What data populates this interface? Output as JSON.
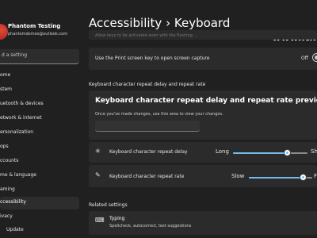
{
  "profile": {
    "name": "Phantom Testing",
    "email": "phantomdemos@outlook.com"
  },
  "search": {
    "placeholder": "d a setting"
  },
  "sidebar": {
    "items": [
      {
        "label": "ome"
      },
      {
        "label": "stem"
      },
      {
        "label": "uetooth & devices"
      },
      {
        "label": "etwork & internet"
      },
      {
        "label": "ersonalization"
      },
      {
        "label": "ops"
      },
      {
        "label": "ccounts"
      },
      {
        "label": "me & language"
      },
      {
        "label": "aming"
      },
      {
        "label": "ccessibility"
      },
      {
        "label": "ivacy"
      },
      {
        "label": "Update"
      }
    ],
    "active_index": 9
  },
  "header": {
    "section": "Accessibility",
    "separator": "›",
    "page": "Keyboard"
  },
  "watermark": "www.ithon",
  "settings": {
    "faded_text": "Allow keys to be activated even with the flashing ...",
    "print_screen": {
      "label": "Use the Print screen key to open screen capture",
      "state": "Off"
    },
    "repeat_section_title": "Keyboard character repeat delay and repeat rate",
    "preview": {
      "title": "Keyboard character repeat delay and repeat rate preview",
      "subtitle": "Once you've made changes, use this area to view your changes.",
      "value": ""
    },
    "repeat_delay": {
      "icon": "repeat-delay-icon",
      "label": "Keyboard character repeat delay",
      "low": "Long",
      "high": "Sh",
      "level": 0.72
    },
    "repeat_rate": {
      "icon": "repeat-rate-icon",
      "label": "Keyboard character repeat rate",
      "low": "Slow",
      "high": "F",
      "level": 0.85
    },
    "related_title": "Related settings",
    "typing": {
      "title": "Typing",
      "subtitle": "Spellcheck, autocorrect, text suggestions"
    }
  },
  "colors": {
    "accent": "#76b9ed",
    "background": "#202020",
    "card": "#2b2b2b"
  }
}
